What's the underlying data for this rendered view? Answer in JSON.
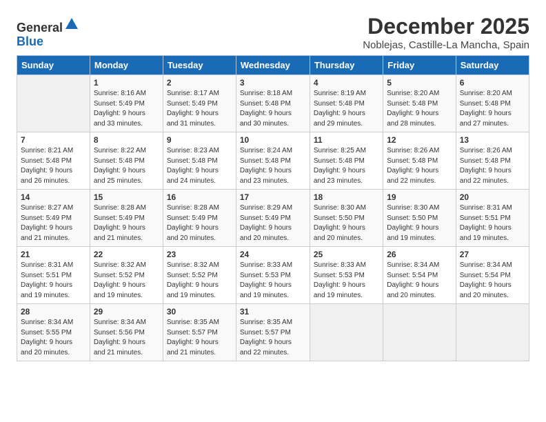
{
  "header": {
    "logo_general": "General",
    "logo_blue": "Blue",
    "title": "December 2025",
    "subtitle": "Noblejas, Castille-La Mancha, Spain"
  },
  "weekdays": [
    "Sunday",
    "Monday",
    "Tuesday",
    "Wednesday",
    "Thursday",
    "Friday",
    "Saturday"
  ],
  "weeks": [
    [
      {
        "day": "",
        "empty": true
      },
      {
        "day": "1",
        "rise": "8:16 AM",
        "set": "5:49 PM",
        "daylight": "9 hours and 33 minutes."
      },
      {
        "day": "2",
        "rise": "8:17 AM",
        "set": "5:49 PM",
        "daylight": "9 hours and 31 minutes."
      },
      {
        "day": "3",
        "rise": "8:18 AM",
        "set": "5:48 PM",
        "daylight": "9 hours and 30 minutes."
      },
      {
        "day": "4",
        "rise": "8:19 AM",
        "set": "5:48 PM",
        "daylight": "9 hours and 29 minutes."
      },
      {
        "day": "5",
        "rise": "8:20 AM",
        "set": "5:48 PM",
        "daylight": "9 hours and 28 minutes."
      },
      {
        "day": "6",
        "rise": "8:20 AM",
        "set": "5:48 PM",
        "daylight": "9 hours and 27 minutes."
      }
    ],
    [
      {
        "day": "7",
        "rise": "8:21 AM",
        "set": "5:48 PM",
        "daylight": "9 hours and 26 minutes."
      },
      {
        "day": "8",
        "rise": "8:22 AM",
        "set": "5:48 PM",
        "daylight": "9 hours and 25 minutes."
      },
      {
        "day": "9",
        "rise": "8:23 AM",
        "set": "5:48 PM",
        "daylight": "9 hours and 24 minutes."
      },
      {
        "day": "10",
        "rise": "8:24 AM",
        "set": "5:48 PM",
        "daylight": "9 hours and 23 minutes."
      },
      {
        "day": "11",
        "rise": "8:25 AM",
        "set": "5:48 PM",
        "daylight": "9 hours and 23 minutes."
      },
      {
        "day": "12",
        "rise": "8:26 AM",
        "set": "5:48 PM",
        "daylight": "9 hours and 22 minutes."
      },
      {
        "day": "13",
        "rise": "8:26 AM",
        "set": "5:48 PM",
        "daylight": "9 hours and 22 minutes."
      }
    ],
    [
      {
        "day": "14",
        "rise": "8:27 AM",
        "set": "5:49 PM",
        "daylight": "9 hours and 21 minutes."
      },
      {
        "day": "15",
        "rise": "8:28 AM",
        "set": "5:49 PM",
        "daylight": "9 hours and 21 minutes."
      },
      {
        "day": "16",
        "rise": "8:28 AM",
        "set": "5:49 PM",
        "daylight": "9 hours and 20 minutes."
      },
      {
        "day": "17",
        "rise": "8:29 AM",
        "set": "5:49 PM",
        "daylight": "9 hours and 20 minutes."
      },
      {
        "day": "18",
        "rise": "8:30 AM",
        "set": "5:50 PM",
        "daylight": "9 hours and 20 minutes."
      },
      {
        "day": "19",
        "rise": "8:30 AM",
        "set": "5:50 PM",
        "daylight": "9 hours and 19 minutes."
      },
      {
        "day": "20",
        "rise": "8:31 AM",
        "set": "5:51 PM",
        "daylight": "9 hours and 19 minutes."
      }
    ],
    [
      {
        "day": "21",
        "rise": "8:31 AM",
        "set": "5:51 PM",
        "daylight": "9 hours and 19 minutes."
      },
      {
        "day": "22",
        "rise": "8:32 AM",
        "set": "5:52 PM",
        "daylight": "9 hours and 19 minutes."
      },
      {
        "day": "23",
        "rise": "8:32 AM",
        "set": "5:52 PM",
        "daylight": "9 hours and 19 minutes."
      },
      {
        "day": "24",
        "rise": "8:33 AM",
        "set": "5:53 PM",
        "daylight": "9 hours and 19 minutes."
      },
      {
        "day": "25",
        "rise": "8:33 AM",
        "set": "5:53 PM",
        "daylight": "9 hours and 19 minutes."
      },
      {
        "day": "26",
        "rise": "8:34 AM",
        "set": "5:54 PM",
        "daylight": "9 hours and 20 minutes."
      },
      {
        "day": "27",
        "rise": "8:34 AM",
        "set": "5:54 PM",
        "daylight": "9 hours and 20 minutes."
      }
    ],
    [
      {
        "day": "28",
        "rise": "8:34 AM",
        "set": "5:55 PM",
        "daylight": "9 hours and 20 minutes."
      },
      {
        "day": "29",
        "rise": "8:34 AM",
        "set": "5:56 PM",
        "daylight": "9 hours and 21 minutes."
      },
      {
        "day": "30",
        "rise": "8:35 AM",
        "set": "5:57 PM",
        "daylight": "9 hours and 21 minutes."
      },
      {
        "day": "31",
        "rise": "8:35 AM",
        "set": "5:57 PM",
        "daylight": "9 hours and 22 minutes."
      },
      {
        "day": "",
        "empty": true
      },
      {
        "day": "",
        "empty": true
      },
      {
        "day": "",
        "empty": true
      }
    ]
  ],
  "labels": {
    "sunrise": "Sunrise:",
    "sunset": "Sunset:",
    "daylight": "Daylight:"
  }
}
